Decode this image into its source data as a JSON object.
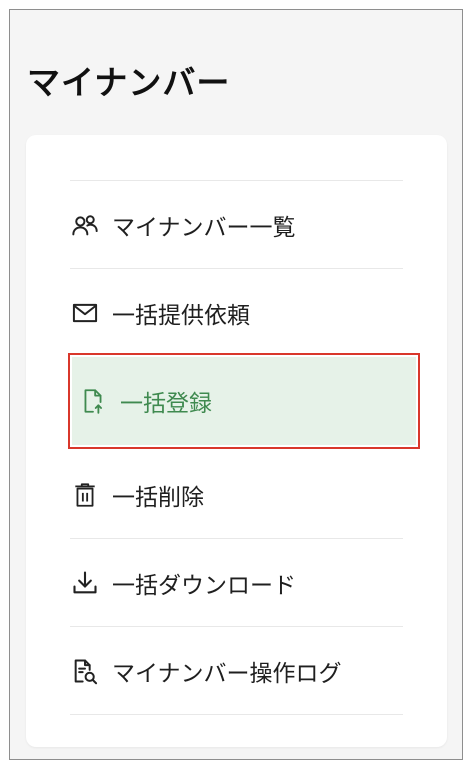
{
  "header": {
    "title": "マイナンバー"
  },
  "menu": {
    "items": [
      {
        "label": "マイナンバー一覧",
        "icon": "users-icon",
        "selected": false
      },
      {
        "label": "一括提供依頼",
        "icon": "mail-icon",
        "selected": false
      },
      {
        "label": "一括登録",
        "icon": "file-upload-icon",
        "selected": true
      },
      {
        "label": "一括削除",
        "icon": "trash-icon",
        "selected": false
      },
      {
        "label": "一括ダウンロード",
        "icon": "download-icon",
        "selected": false
      },
      {
        "label": "マイナンバー操作ログ",
        "icon": "document-search-icon",
        "selected": false
      }
    ]
  },
  "colors": {
    "selected_bg": "#e6f2e8",
    "selected_text": "#3f8a4f",
    "highlight_border": "#d9372b"
  }
}
